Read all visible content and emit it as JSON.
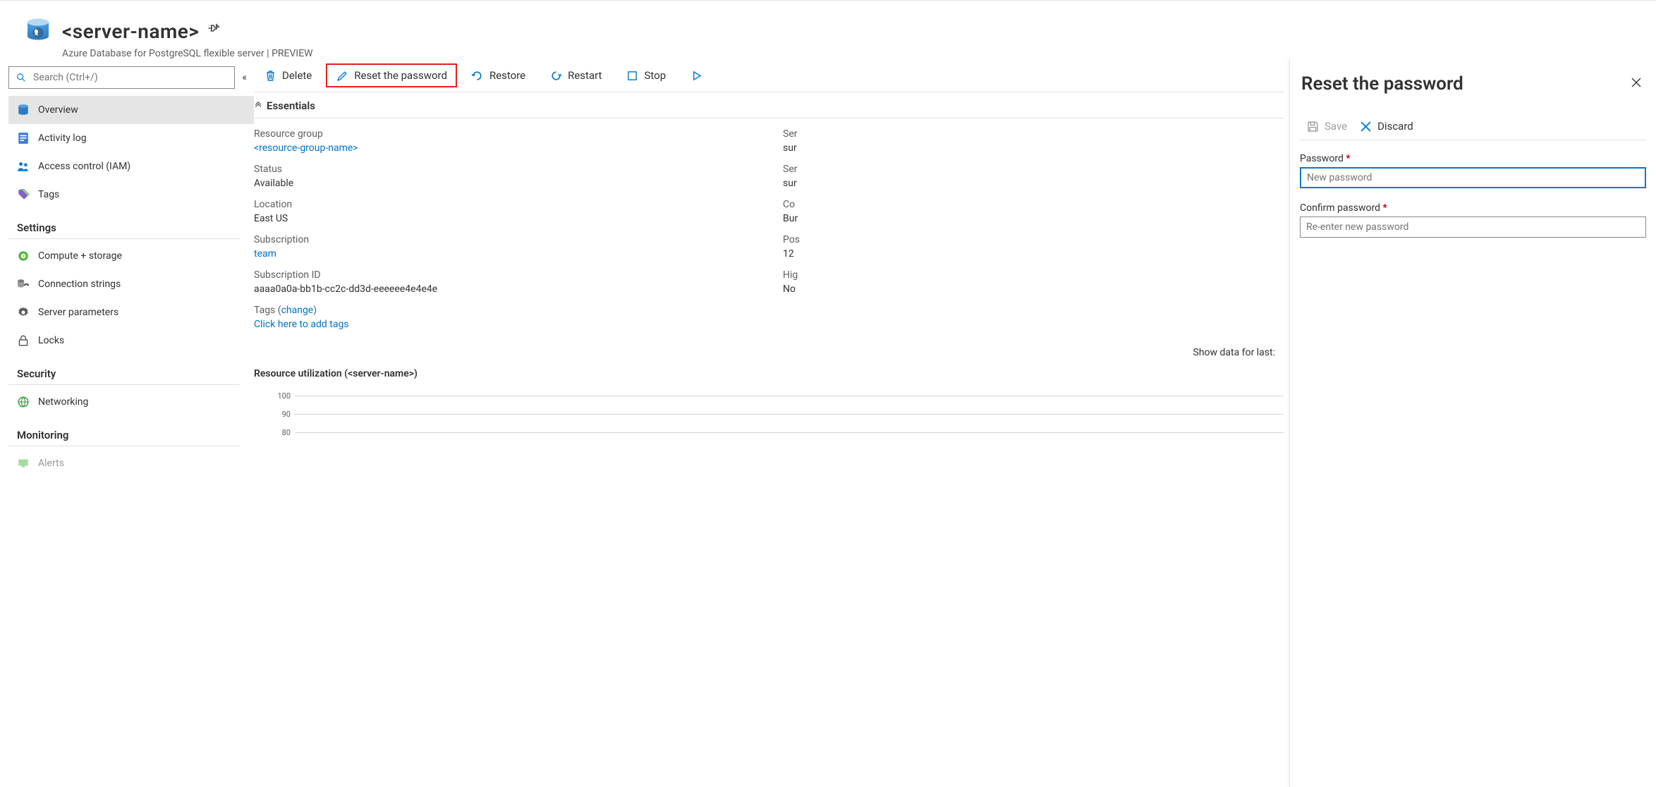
{
  "resource": {
    "title": "<server-name>",
    "subtitle": "Azure Database for PostgreSQL flexible server | PREVIEW"
  },
  "sidebar": {
    "search_placeholder": "Search (Ctrl+/)",
    "items": [
      {
        "label": "Overview",
        "icon": "server-icon",
        "active": true
      },
      {
        "label": "Activity log",
        "icon": "log-icon"
      },
      {
        "label": "Access control (IAM)",
        "icon": "people-icon"
      },
      {
        "label": "Tags",
        "icon": "tag-icon"
      }
    ],
    "groups": [
      {
        "label": "Settings",
        "items": [
          {
            "label": "Compute + storage",
            "icon": "compute-icon"
          },
          {
            "label": "Connection strings",
            "icon": "conn-icon"
          },
          {
            "label": "Server parameters",
            "icon": "gear-icon"
          },
          {
            "label": "Locks",
            "icon": "lock-icon"
          }
        ]
      },
      {
        "label": "Security",
        "items": [
          {
            "label": "Networking",
            "icon": "network-icon"
          }
        ]
      },
      {
        "label": "Monitoring",
        "items": [
          {
            "label": "Alerts",
            "icon": "alerts-icon"
          }
        ]
      }
    ]
  },
  "commandbar": {
    "delete": "Delete",
    "reset_password": "Reset the password",
    "restore": "Restore",
    "restart": "Restart",
    "stop": "Stop"
  },
  "essentials": {
    "header": "Essentials",
    "left": {
      "resource_group": {
        "label": "Resource group",
        "value": "<resource-group-name>",
        "link": true
      },
      "status": {
        "label": "Status",
        "value": "Available"
      },
      "location": {
        "label": "Location",
        "value": "East US"
      },
      "subscription": {
        "label": "Subscription",
        "value": "team",
        "link": true
      },
      "sub_id": {
        "label": "Subscription ID",
        "value": "aaaa0a0a-bb1b-cc2c-dd3d-eeeeee4e4e4e"
      }
    },
    "right": {
      "server_name": {
        "label": "Ser",
        "value": "sur"
      },
      "server_admin": {
        "label": "Ser",
        "value": "sur"
      },
      "configuration": {
        "label": "Co",
        "value": "Bur"
      },
      "pg_version": {
        "label": "Pos",
        "value": "12"
      },
      "ha": {
        "label": "Hig",
        "value": "No"
      }
    },
    "tags": {
      "label_prefix": "Tags (",
      "change": "change",
      "label_suffix": ")",
      "add": "Click here to add tags"
    }
  },
  "show_data_label": "Show data for last:",
  "chart": {
    "title": "Resource utilization (<server-name>)"
  },
  "chart_data": {
    "type": "line",
    "title": "Resource utilization (<server-name>)",
    "ylim": [
      0,
      100
    ],
    "yticks": [
      100,
      90,
      80
    ],
    "series": []
  },
  "panel": {
    "title": "Reset the password",
    "save": "Save",
    "discard": "Discard",
    "password_label": "Password",
    "password_placeholder": "New password",
    "confirm_label": "Confirm password",
    "confirm_placeholder": "Re-enter new password"
  }
}
